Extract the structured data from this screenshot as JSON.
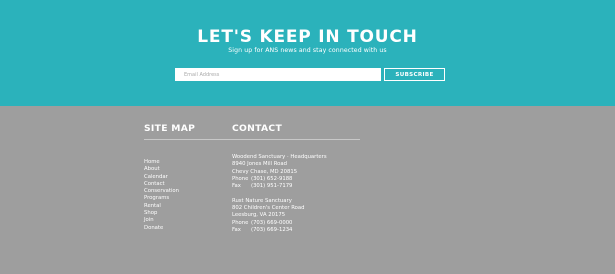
{
  "signup": {
    "title": "LET'S KEEP IN TOUCH",
    "subtitle": "Sign up for ANS news and stay connected with us",
    "email_placeholder": "Email Address",
    "subscribe_label": "SUBSCRIBE"
  },
  "footer": {
    "sitemap_heading": "SITE MAP",
    "contact_heading": "CONTACT",
    "sitemap_links": [
      "Home",
      "About",
      "Calendar",
      "Contact",
      "Conservation",
      "Programs",
      "Rental",
      "Shop",
      "Join",
      "Donate"
    ],
    "locations": [
      {
        "name": "Woodend Sanctuary · Headquarters",
        "street": "8940 Jones Mill Road",
        "city": "Chevy Chase, MD 20815",
        "phone_label": "Phone",
        "phone": "(301) 652-9188",
        "fax_label": "Fax",
        "fax": "(301) 951-7179"
      },
      {
        "name": "Rust Nature Sanctuary",
        "street": "802 Children's Center Road",
        "city": "Leesburg, VA 20175",
        "phone_label": "Phone",
        "phone": "(703) 669-0000",
        "fax_label": "Fax",
        "fax": "(703) 669-1234"
      }
    ]
  },
  "colors": {
    "signup_background": "#2bb2bb",
    "footer_background": "#9e9e9e",
    "text": "#ffffff"
  }
}
